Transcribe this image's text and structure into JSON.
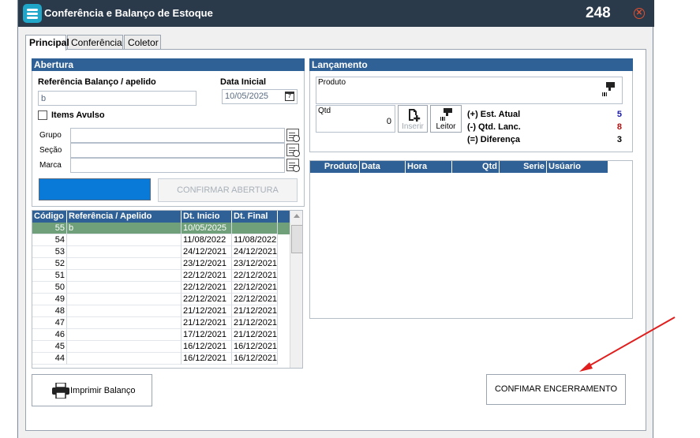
{
  "window": {
    "title": "Conferência e Balanço de Estoque",
    "number": "248"
  },
  "tabs": [
    {
      "label": "Principal",
      "active": true
    },
    {
      "label": "Conferência",
      "active": false
    },
    {
      "label": "Coletor",
      "active": false
    }
  ],
  "abertura": {
    "header": "Abertura",
    "ref_label": "Referência Balanço / apelido",
    "ref_value": "b",
    "date_label": "Data Inicial",
    "date_value": "10/05/2025",
    "items_avulso_label": "Items Avulso",
    "items_avulso_checked": false,
    "grupo_label": "Grupo",
    "secao_label": "Seção",
    "marca_label": "Marca",
    "confirm_label": "CONFIRMAR ABERTURA",
    "blue_button_label": ""
  },
  "balancos": {
    "columns": [
      "Código",
      "Referência / Apelido",
      "Dt. Inicio",
      "Dt. Final"
    ],
    "rows": [
      {
        "codigo": "55",
        "ref": "b",
        "inicio": "10/05/2025",
        "final": "",
        "selected": true
      },
      {
        "codigo": "54",
        "ref": "",
        "inicio": "11/08/2022",
        "final": "11/08/2022"
      },
      {
        "codigo": "53",
        "ref": "",
        "inicio": "24/12/2021",
        "final": "24/12/2021"
      },
      {
        "codigo": "52",
        "ref": "",
        "inicio": "23/12/2021",
        "final": "23/12/2021"
      },
      {
        "codigo": "51",
        "ref": "",
        "inicio": "22/12/2021",
        "final": "22/12/2021"
      },
      {
        "codigo": "50",
        "ref": "",
        "inicio": "22/12/2021",
        "final": "22/12/2021"
      },
      {
        "codigo": "49",
        "ref": "",
        "inicio": "22/12/2021",
        "final": "22/12/2021"
      },
      {
        "codigo": "48",
        "ref": "",
        "inicio": "21/12/2021",
        "final": "21/12/2021"
      },
      {
        "codigo": "47",
        "ref": "",
        "inicio": "21/12/2021",
        "final": "21/12/2021"
      },
      {
        "codigo": "46",
        "ref": "",
        "inicio": "17/12/2021",
        "final": "21/12/2021"
      },
      {
        "codigo": "45",
        "ref": "",
        "inicio": "16/12/2021",
        "final": "16/12/2021"
      },
      {
        "codigo": "44",
        "ref": "",
        "inicio": "16/12/2021",
        "final": "16/12/2021"
      }
    ]
  },
  "lancamento": {
    "header": "Lançamento",
    "produto_label": "Produto",
    "qtd_label": "Qtd",
    "qtd_value": "0",
    "inserir_label": "Inserir",
    "leitor_label": "Leitor",
    "est_atual_label": "(+) Est. Atual",
    "est_atual_value": "5",
    "est_atual_color": "#1a1aa8",
    "qtd_lanc_label": "(-) Qtd. Lanc.",
    "qtd_lanc_value": "8",
    "qtd_lanc_color": "#b01010",
    "diferenca_label": "(=) Diferença",
    "diferenca_value": "3"
  },
  "lancamentos_table": {
    "columns": [
      "Produto",
      "Data",
      "Hora",
      "Qtd",
      "Serie",
      "Usúario"
    ]
  },
  "footer": {
    "print_label": "Imprimir Balanço",
    "encerramento_label": "CONFIMAR ENCERRAMENTO"
  },
  "colors": {
    "titlebar": "#2b3a4a",
    "header_blue": "#2f6096",
    "selected_row": "#70a07a",
    "blue_button": "#0a7ad8",
    "annotation_arrow": "#e01e1e"
  }
}
